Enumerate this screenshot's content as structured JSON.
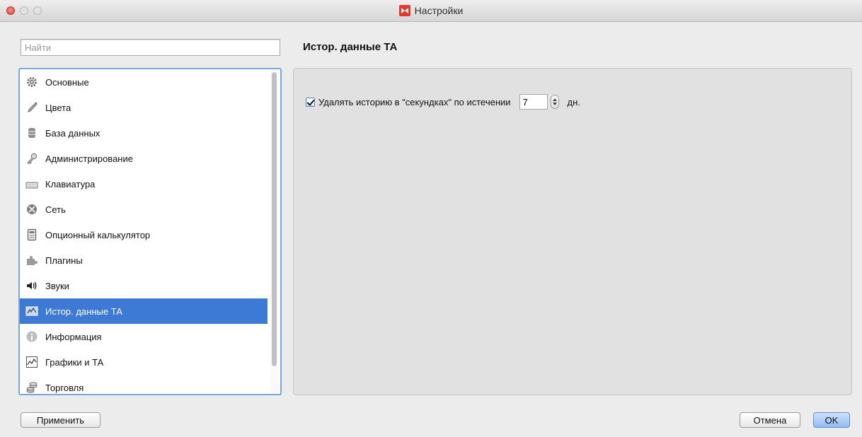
{
  "window": {
    "title": "Настройки"
  },
  "search": {
    "placeholder": "Найти",
    "value": ""
  },
  "sidebar": {
    "items": [
      {
        "label": "Основные",
        "icon": "gear-icon"
      },
      {
        "label": "Цвета",
        "icon": "brush-icon"
      },
      {
        "label": "База данных",
        "icon": "database-icon"
      },
      {
        "label": "Администрирование",
        "icon": "key-icon"
      },
      {
        "label": "Клавиатура",
        "icon": "keyboard-icon"
      },
      {
        "label": "Сеть",
        "icon": "network-icon"
      },
      {
        "label": "Опционный калькулятор",
        "icon": "calculator-icon"
      },
      {
        "label": "Плагины",
        "icon": "puzzle-icon"
      },
      {
        "label": "Звуки",
        "icon": "speaker-icon"
      },
      {
        "label": "Истор. данные ТА",
        "icon": "history-data-icon",
        "selected": true
      },
      {
        "label": "Информация",
        "icon": "info-icon"
      },
      {
        "label": "Графики и ТА",
        "icon": "chart-icon"
      },
      {
        "label": "Торговля",
        "icon": "coins-icon"
      }
    ]
  },
  "main": {
    "title": "Истор. данные ТА",
    "option": {
      "checked": true,
      "label": "Удалять историю в \"секундках\" по истечении",
      "days_value": "7",
      "unit": "дн."
    }
  },
  "buttons": {
    "apply": "Применить",
    "cancel": "Отмена",
    "ok": "OK"
  },
  "colors": {
    "selection": "#3d7ad5",
    "focus_ring": "#7aa7e0",
    "close_button": "#e0443e",
    "app_logo": "#e8362b"
  }
}
